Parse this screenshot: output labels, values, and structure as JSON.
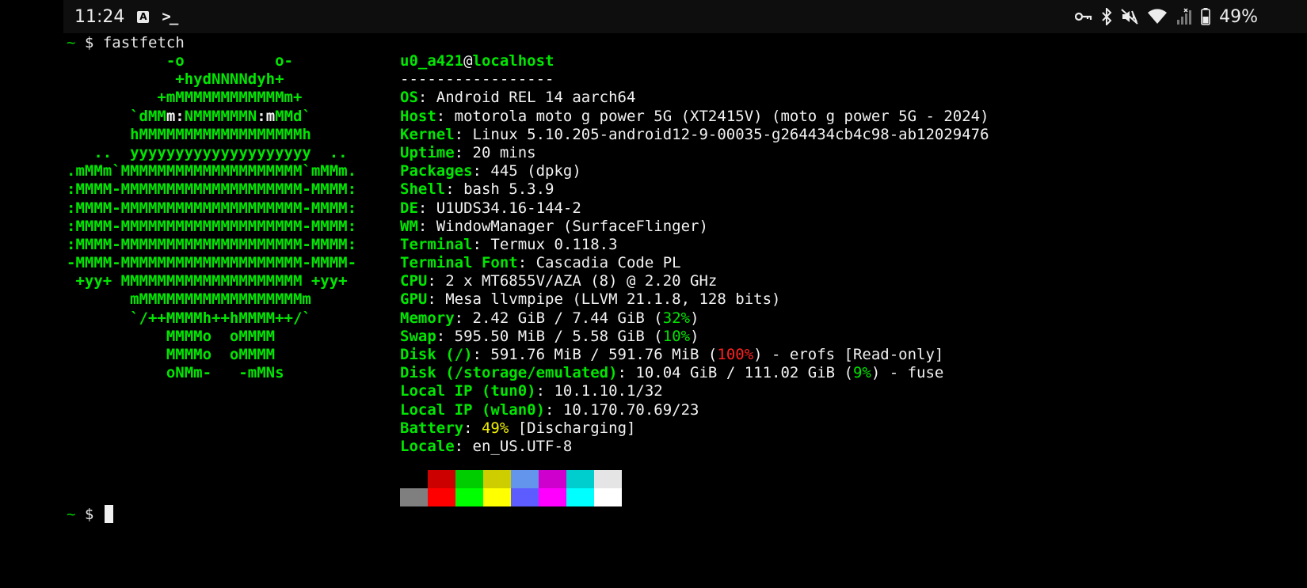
{
  "status": {
    "time": "11:24",
    "battery_pct": "49%",
    "icons": [
      "keyboard-a-icon",
      "terminal-icon",
      "vpn-key-icon",
      "bluetooth-icon",
      "mute-icon",
      "wifi-icon",
      "signal-icon",
      "battery-icon"
    ]
  },
  "terminal": {
    "prompt_tilde": "~",
    "prompt_dollar": "$",
    "command": "fastfetch",
    "logo": [
      [
        {
          "t": "           -o          o-",
          "c": "g"
        }
      ],
      [
        {
          "t": "            +hydNNNNdyh+",
          "c": "g"
        }
      ],
      [
        {
          "t": "          +mMMMMMMMMMMMMm+",
          "c": "g"
        }
      ],
      [
        {
          "t": "       `dMM",
          "c": "g"
        },
        {
          "t": "m:",
          "c": "w"
        },
        {
          "t": "NMMMMMMN",
          "c": "g"
        },
        {
          "t": ":m",
          "c": "w"
        },
        {
          "t": "MMd`",
          "c": "g"
        }
      ],
      [
        {
          "t": "       hMMMMMMMMMMMMMMMMMMh",
          "c": "g"
        }
      ],
      [
        {
          "t": "   ..  yyyyyyyyyyyyyyyyyyyy  ..",
          "c": "g"
        }
      ],
      [
        {
          "t": ".mMMm`MMMMMMMMMMMMMMMMMMMM`mMMm.",
          "c": "g"
        }
      ],
      [
        {
          "t": ":MMMM-MMMMMMMMMMMMMMMMMMMM-MMMM:",
          "c": "g"
        }
      ],
      [
        {
          "t": ":MMMM-MMMMMMMMMMMMMMMMMMMM-MMMM:",
          "c": "g"
        }
      ],
      [
        {
          "t": ":MMMM-MMMMMMMMMMMMMMMMMMMM-MMMM:",
          "c": "g"
        }
      ],
      [
        {
          "t": ":MMMM-MMMMMMMMMMMMMMMMMMMM-MMMM:",
          "c": "g"
        }
      ],
      [
        {
          "t": "-MMMM-MMMMMMMMMMMMMMMMMMMM-MMMM-",
          "c": "g"
        }
      ],
      [
        {
          "t": " +yy+ MMMMMMMMMMMMMMMMMMMM +yy+",
          "c": "g"
        }
      ],
      [
        {
          "t": "       mMMMMMMMMMMMMMMMMMMm",
          "c": "g"
        }
      ],
      [
        {
          "t": "       `/++MMMMh++hMMMM++/`",
          "c": "g"
        }
      ],
      [
        {
          "t": "           MMMMo  oMMMM",
          "c": "g"
        }
      ],
      [
        {
          "t": "           MMMMo  oMMMM",
          "c": "g"
        }
      ],
      [
        {
          "t": "           oNMm-   -mMNs",
          "c": "g"
        }
      ]
    ],
    "info": [
      [
        {
          "t": "u0_a421",
          "c": "k"
        },
        {
          "t": "@",
          "c": "w"
        },
        {
          "t": "localhost",
          "c": "k"
        }
      ],
      [
        {
          "t": "-----------------",
          "c": "w"
        }
      ],
      [
        {
          "t": "OS",
          "c": "k"
        },
        {
          "t": ": Android REL 14 aarch64",
          "c": "w"
        }
      ],
      [
        {
          "t": "Host",
          "c": "k"
        },
        {
          "t": ": motorola moto g power 5G (XT2415V) (moto g power 5G - 2024)",
          "c": "w"
        }
      ],
      [
        {
          "t": "Kernel",
          "c": "k"
        },
        {
          "t": ": Linux 5.10.205-android12-9-00035-g264434cb4c98-ab12029476",
          "c": "w"
        }
      ],
      [
        {
          "t": "Uptime",
          "c": "k"
        },
        {
          "t": ": 20 mins",
          "c": "w"
        }
      ],
      [
        {
          "t": "Packages",
          "c": "k"
        },
        {
          "t": ": 445 (dpkg)",
          "c": "w"
        }
      ],
      [
        {
          "t": "Shell",
          "c": "k"
        },
        {
          "t": ": bash 5.3.9",
          "c": "w"
        }
      ],
      [
        {
          "t": "DE",
          "c": "k"
        },
        {
          "t": ": U1UDS34.16-144-2",
          "c": "w"
        }
      ],
      [
        {
          "t": "WM",
          "c": "k"
        },
        {
          "t": ": WindowManager (SurfaceFlinger)",
          "c": "w"
        }
      ],
      [
        {
          "t": "Terminal",
          "c": "k"
        },
        {
          "t": ": Termux 0.118.3",
          "c": "w"
        }
      ],
      [
        {
          "t": "Terminal Font",
          "c": "k"
        },
        {
          "t": ": Cascadia Code PL",
          "c": "w"
        }
      ],
      [
        {
          "t": "CPU",
          "c": "k"
        },
        {
          "t": ": 2 x MT6855V/AZA (8) @ 2.20 GHz",
          "c": "w"
        }
      ],
      [
        {
          "t": "GPU",
          "c": "k"
        },
        {
          "t": ": Mesa llvmpipe (LLVM 21.1.8, 128 bits)",
          "c": "w"
        }
      ],
      [
        {
          "t": "Memory",
          "c": "k"
        },
        {
          "t": ": 2.42 GiB / 7.44 GiB (",
          "c": "w"
        },
        {
          "t": "32%",
          "c": "g"
        },
        {
          "t": ")",
          "c": "w"
        }
      ],
      [
        {
          "t": "Swap",
          "c": "k"
        },
        {
          "t": ": 595.50 MiB / 5.58 GiB (",
          "c": "w"
        },
        {
          "t": "10%",
          "c": "g"
        },
        {
          "t": ")",
          "c": "w"
        }
      ],
      [
        {
          "t": "Disk (/)",
          "c": "k"
        },
        {
          "t": ": 591.76 MiB / 591.76 MiB (",
          "c": "w"
        },
        {
          "t": "100%",
          "c": "r"
        },
        {
          "t": ") - erofs [Read-only]",
          "c": "w"
        }
      ],
      [
        {
          "t": "Disk (/storage/emulated)",
          "c": "k"
        },
        {
          "t": ": 10.04 GiB / 111.02 GiB (",
          "c": "w"
        },
        {
          "t": "9%",
          "c": "g"
        },
        {
          "t": ") - fuse",
          "c": "w"
        }
      ],
      [
        {
          "t": "Local IP (tun0)",
          "c": "k"
        },
        {
          "t": ": 10.1.10.1/32",
          "c": "w"
        }
      ],
      [
        {
          "t": "Local IP (wlan0)",
          "c": "k"
        },
        {
          "t": ": 10.170.70.69/23",
          "c": "w"
        }
      ],
      [
        {
          "t": "Battery",
          "c": "k"
        },
        {
          "t": ": ",
          "c": "w"
        },
        {
          "t": "49%",
          "c": "y"
        },
        {
          "t": " [Discharging]",
          "c": "w"
        }
      ],
      [
        {
          "t": "Locale",
          "c": "k"
        },
        {
          "t": ": en_US.UTF-8",
          "c": "w"
        }
      ]
    ],
    "palette_top": [
      "#000000",
      "#cd0000",
      "#00cd00",
      "#cdcd00",
      "#6495ed",
      "#cd00cd",
      "#00cdcd",
      "#e5e5e5"
    ],
    "palette_bottom": [
      "#7f7f7f",
      "#ff0000",
      "#00ff00",
      "#ffff00",
      "#5c5cff",
      "#ff00ff",
      "#00ffff",
      "#ffffff"
    ]
  }
}
